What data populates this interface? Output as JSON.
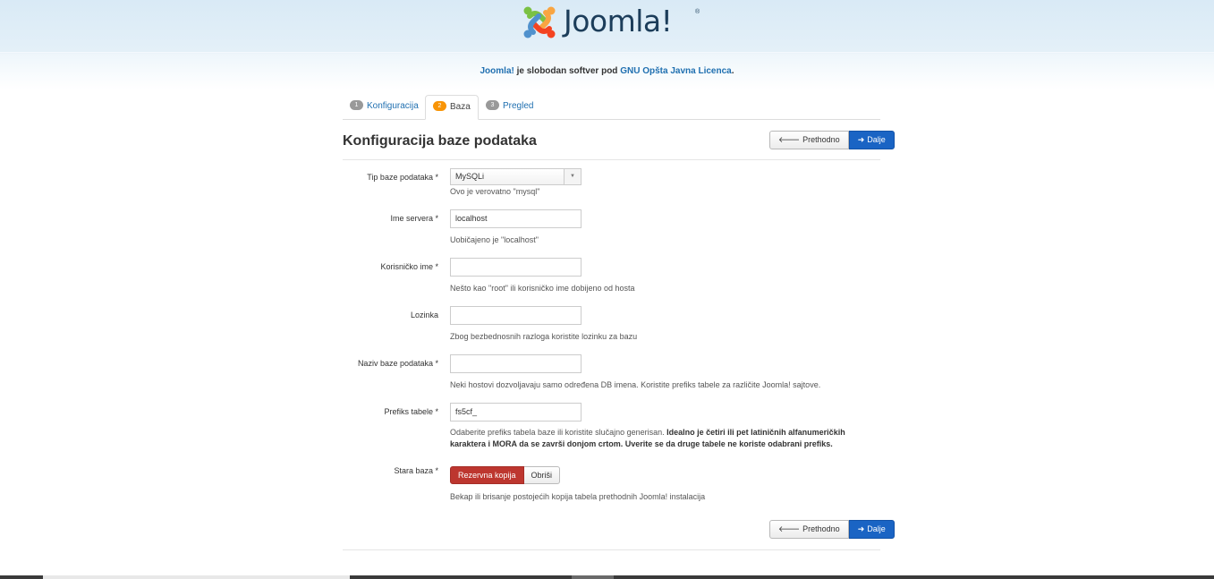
{
  "header": {
    "logo_text": "Joomla!",
    "logo_reg": "®",
    "license_brand": "Joomla!",
    "license_mid": " je slobodan softver pod ",
    "license_link": "GNU Opšta Javna Licenca",
    "license_end": "."
  },
  "tabs": [
    {
      "num": "1",
      "label": "Konfiguracija"
    },
    {
      "num": "2",
      "label": "Baza"
    },
    {
      "num": "3",
      "label": "Pregled"
    }
  ],
  "page_title": "Konfiguracija baze podataka",
  "nav": {
    "prev_label": "Prethodno",
    "next_label": "Dalje"
  },
  "form": {
    "db_type": {
      "label": "Tip baze podataka *",
      "value": "MySQLi",
      "help": "Ovo je verovatno \"mysql\""
    },
    "host": {
      "label": "Ime servera *",
      "value": "localhost",
      "help": "Uobičajeno je \"localhost\""
    },
    "user": {
      "label": "Korisničko ime *",
      "value": "",
      "help": "Nešto kao \"root\" ili korisničko ime dobijeno od hosta"
    },
    "password": {
      "label": "Lozinka",
      "value": "",
      "help": "Zbog bezbednosnih razloga koristite lozinku za bazu"
    },
    "db_name": {
      "label": "Naziv baze podataka *",
      "value": "",
      "help": "Neki hostovi dozvoljavaju samo određena DB imena. Koristite prefiks tabele za različite Joomla! sajtove."
    },
    "prefix": {
      "label": "Prefiks tabele *",
      "value": "fs5cf_",
      "help_normal": "Odaberite prefiks tabela baze ili koristite slučajno generisan. ",
      "help_bold_1": "Idealno je četiri ili pet latiničnih alfanumeričkih",
      "help_bold_2": "karaktera i MORA da se završi donjom crtom. Uverite se da druge tabele ne koriste odabrani prefiks."
    },
    "old_db": {
      "label": "Stara baza *",
      "backup_label": "Rezervna kopija",
      "remove_label": "Obriši",
      "help": "Bekap ili brisanje postojećih kopija tabela prethodnih Joomla! instalacija"
    }
  },
  "colors": {
    "accent": "#1a64c4",
    "danger": "#bd362f",
    "tab_active_badge": "#f89406"
  }
}
